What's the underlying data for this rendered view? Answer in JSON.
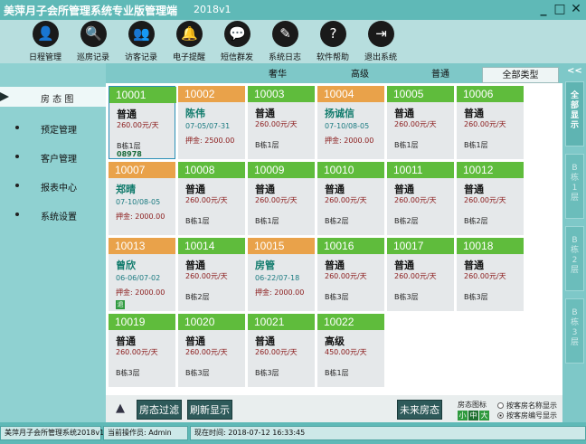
{
  "app": {
    "title": "美萍月子会所管理系统专业版管理端",
    "version": "2018v1",
    "win_buttons": [
      "_",
      "□",
      "✕"
    ]
  },
  "toolbar": [
    {
      "label": "日程管理",
      "icon": "person-add-icon",
      "glyph": "👤"
    },
    {
      "label": "巡房记录",
      "icon": "inspection-doc-icon",
      "glyph": "🔍"
    },
    {
      "label": "访客记录",
      "icon": "visitors-icon",
      "glyph": "👥"
    },
    {
      "label": "电子提醒",
      "icon": "bell-icon",
      "glyph": "🔔"
    },
    {
      "label": "短信群发",
      "icon": "message-icon",
      "glyph": "💬"
    },
    {
      "label": "系统日志",
      "icon": "log-edit-icon",
      "glyph": "✎"
    },
    {
      "label": "软件帮助",
      "icon": "help-icon",
      "glyph": "?"
    },
    {
      "label": "退出系统",
      "icon": "exit-icon",
      "glyph": "⇥"
    }
  ],
  "nav": [
    {
      "label": "房 态 图",
      "active": true
    },
    {
      "label": "预定管理",
      "active": false
    },
    {
      "label": "客户管理",
      "active": false
    },
    {
      "label": "报表中心",
      "active": false
    },
    {
      "label": "系统设置",
      "active": false
    }
  ],
  "filters": [
    "奢华",
    "高级",
    "普通",
    "全部类型"
  ],
  "rooms": [
    {
      "num": "10001",
      "state": "free",
      "selected": true,
      "type": "普通",
      "price": "260.00元/天",
      "building": "B栋1层",
      "code": "08978"
    },
    {
      "num": "10002",
      "state": "occ",
      "guest": "陈伟",
      "dates": "07-05/07-31",
      "deposit": "押金: 2500.00"
    },
    {
      "num": "10003",
      "state": "free",
      "type": "普通",
      "price": "260.00元/天",
      "building": "B栋1层"
    },
    {
      "num": "10004",
      "state": "occ",
      "guest": "扬诚信",
      "dates": "07-10/08-05",
      "deposit": "押金: 2000.00"
    },
    {
      "num": "10005",
      "state": "free",
      "type": "普通",
      "price": "260.00元/天",
      "building": "B栋1层"
    },
    {
      "num": "10006",
      "state": "free",
      "type": "普通",
      "price": "260.00元/天",
      "building": "B栋1层"
    },
    {
      "num": "10007",
      "state": "occ",
      "guest": "郑晴",
      "dates": "07-10/08-05",
      "deposit": "押金: 2000.00"
    },
    {
      "num": "10008",
      "state": "free",
      "type": "普通",
      "price": "260.00元/天",
      "building": "B栋1层"
    },
    {
      "num": "10009",
      "state": "free",
      "type": "普通",
      "price": "260.00元/天",
      "building": "B栋1层"
    },
    {
      "num": "10010",
      "state": "free",
      "type": "普通",
      "price": "260.00元/天",
      "building": "B栋2层"
    },
    {
      "num": "10011",
      "state": "free",
      "type": "普通",
      "price": "260.00元/天",
      "building": "B栋2层"
    },
    {
      "num": "10012",
      "state": "free",
      "type": "普通",
      "price": "260.00元/天",
      "building": "B栋2层"
    },
    {
      "num": "10013",
      "state": "occ",
      "guest": "曾欣",
      "dates": "06-06/07-02",
      "deposit": "押金: 2000.00",
      "tag": "退"
    },
    {
      "num": "10014",
      "state": "free",
      "type": "普通",
      "price": "260.00元/天",
      "building": "B栋2层"
    },
    {
      "num": "10015",
      "state": "occ",
      "guest": "房管",
      "dates": "06-22/07-18",
      "deposit": "押金: 2000.00"
    },
    {
      "num": "10016",
      "state": "free",
      "type": "普通",
      "price": "260.00元/天",
      "building": "B栋3层"
    },
    {
      "num": "10017",
      "state": "free",
      "type": "普通",
      "price": "260.00元/天",
      "building": "B栋3层"
    },
    {
      "num": "10018",
      "state": "free",
      "type": "普通",
      "price": "260.00元/天",
      "building": "B栋3层"
    },
    {
      "num": "10019",
      "state": "free",
      "type": "普通",
      "price": "260.00元/天",
      "building": "B栋3层"
    },
    {
      "num": "10020",
      "state": "free",
      "type": "普通",
      "price": "260.00元/天",
      "building": "B栋3层"
    },
    {
      "num": "10021",
      "state": "free",
      "type": "普通",
      "price": "260.00元/天",
      "building": "B栋3层"
    },
    {
      "num": "10022",
      "state": "free",
      "type": "高级",
      "price": "450.00元/天",
      "building": "B栋1层"
    }
  ],
  "right_tabs": [
    "全部显示",
    "B栋1层",
    "B栋2层",
    "B栋3层"
  ],
  "right_toggle": "<<",
  "controls": {
    "up": "▲",
    "filter_btn": "房态过滤",
    "refresh_btn": "刷新显示",
    "future_btn": "未来房态",
    "legend_title": "房态图标",
    "legend_sizes": [
      "小",
      "中",
      "大"
    ],
    "radio_name": "按客房名称显示",
    "radio_number": "按客房编号显示"
  },
  "status": {
    "app_version": "美萍月子会所管理系统2018v1",
    "operator": "当前操作员: Admin",
    "time": "现在时间: 2018-07-12 16:33:45"
  },
  "colors": {
    "free_header": "#5fbc3c",
    "occupied_header": "#e9a24a",
    "title_bar": "#5fb9b7"
  }
}
